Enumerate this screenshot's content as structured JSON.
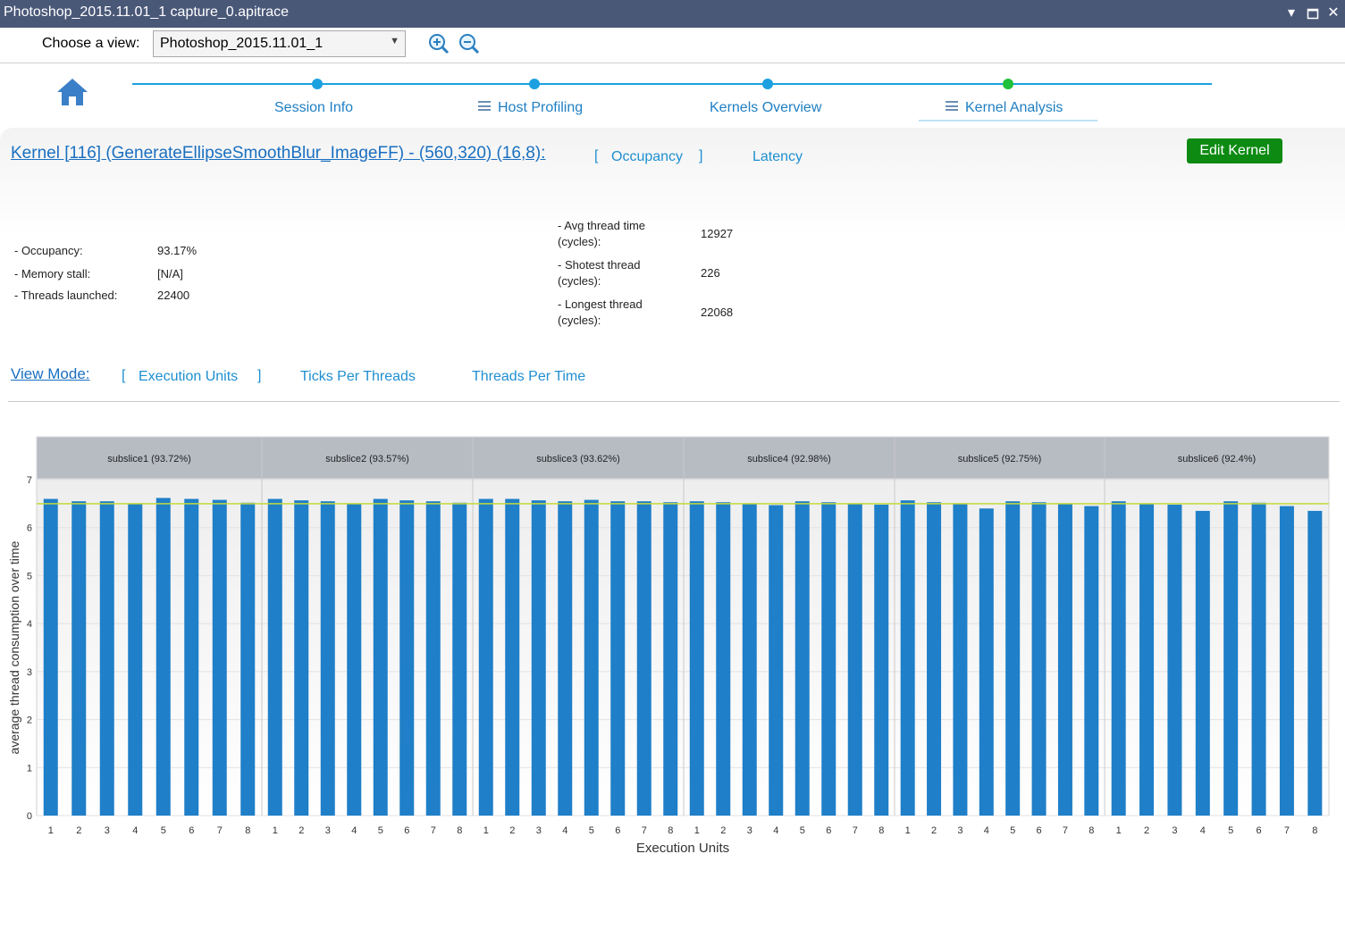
{
  "window": {
    "title": "Photoshop_2015.11.01_1 capture_0.apitrace"
  },
  "toolbar": {
    "choose_view_label": "Choose a view:",
    "view_value": "Photoshop_2015.11.01_1"
  },
  "nav": {
    "steps": [
      {
        "label": "Session Info",
        "has_menu": false
      },
      {
        "label": "Host Profiling",
        "has_menu": true
      },
      {
        "label": "Kernels Overview",
        "has_menu": false
      },
      {
        "label": "Kernel Analysis",
        "has_menu": true,
        "active": true
      }
    ]
  },
  "kernel": {
    "title": "Kernel [116] (GenerateEllipseSmoothBlur_ImageFF) - (560,320) (16,8):",
    "modes": {
      "occupancy": "Occupancy",
      "latency": "Latency",
      "bracket_open": "[",
      "bracket_close": "]"
    },
    "edit_button": "Edit Kernel"
  },
  "stats_left": [
    {
      "label": "- Occupancy:",
      "value": "93.17%"
    },
    {
      "label": "- Memory stall:",
      "value": "[N/A]"
    },
    {
      "label": "- Threads launched:",
      "value": "22400"
    }
  ],
  "stats_right": [
    {
      "label1": "- Avg thread time",
      "label2": "(cycles):",
      "value": "12927"
    },
    {
      "label1": "- Shotest thread",
      "label2": "(cycles):",
      "value": "226"
    },
    {
      "label1": "- Longest thread",
      "label2": "(cycles):",
      "value": "22068"
    }
  ],
  "view_mode": {
    "label": "View Mode:",
    "execution_units": "Execution Units",
    "ticks_per_threads": "Ticks Per Threads",
    "threads_per_time": "Threads Per Time",
    "bracket_open": "[",
    "bracket_close": "]"
  },
  "colors": {
    "bar": "#1f7fc8",
    "reference_line": "#c4d93a",
    "nav_line": "#1ca0e0",
    "active_dot": "#20c03a",
    "edit_button": "#0d8a12"
  },
  "chart_data": {
    "type": "bar",
    "xlabel": "Execution Units",
    "ylabel": "average thread consumption over time",
    "ylim": [
      0,
      7
    ],
    "yticks": [
      0,
      1,
      2,
      3,
      4,
      5,
      6,
      7
    ],
    "reference_line": 6.5,
    "groups": [
      {
        "name": "subslice1 (93.72%)",
        "categories": [
          "1",
          "2",
          "3",
          "4",
          "5",
          "6",
          "7",
          "8"
        ],
        "values": [
          6.6,
          6.55,
          6.55,
          6.5,
          6.62,
          6.6,
          6.58,
          6.52
        ]
      },
      {
        "name": "subslice2 (93.57%)",
        "categories": [
          "1",
          "2",
          "3",
          "4",
          "5",
          "6",
          "7",
          "8"
        ],
        "values": [
          6.6,
          6.57,
          6.55,
          6.5,
          6.6,
          6.57,
          6.55,
          6.52
        ]
      },
      {
        "name": "subslice3 (93.62%)",
        "categories": [
          "1",
          "2",
          "3",
          "4",
          "5",
          "6",
          "7",
          "8"
        ],
        "values": [
          6.6,
          6.6,
          6.57,
          6.55,
          6.58,
          6.55,
          6.55,
          6.53
        ]
      },
      {
        "name": "subslice4 (92.98%)",
        "categories": [
          "1",
          "2",
          "3",
          "4",
          "5",
          "6",
          "7",
          "8"
        ],
        "values": [
          6.55,
          6.53,
          6.5,
          6.47,
          6.55,
          6.53,
          6.5,
          6.48
        ]
      },
      {
        "name": "subslice5 (92.75%)",
        "categories": [
          "1",
          "2",
          "3",
          "4",
          "5",
          "6",
          "7",
          "8"
        ],
        "values": [
          6.57,
          6.53,
          6.5,
          6.4,
          6.55,
          6.53,
          6.5,
          6.45
        ]
      },
      {
        "name": "subslice6 (92.4%)",
        "categories": [
          "1",
          "2",
          "3",
          "4",
          "5",
          "6",
          "7",
          "8"
        ],
        "values": [
          6.55,
          6.5,
          6.48,
          6.35,
          6.55,
          6.52,
          6.45,
          6.35
        ]
      }
    ]
  }
}
